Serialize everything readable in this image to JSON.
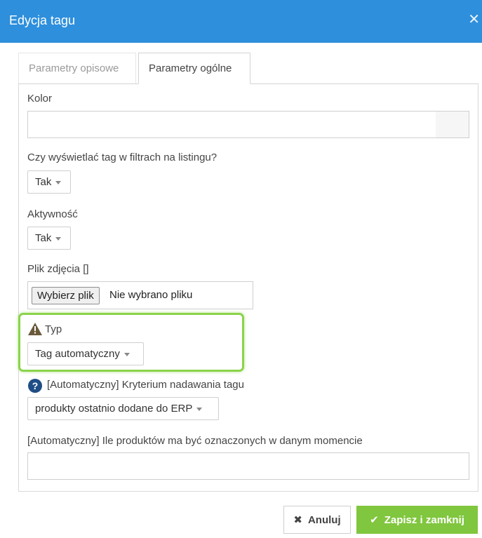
{
  "dialog": {
    "title": "Edycja tagu",
    "close_icon": "close-icon"
  },
  "tabs": [
    {
      "label": "Parametry opisowe",
      "active": false
    },
    {
      "label": "Parametry ogólne",
      "active": true
    }
  ],
  "form": {
    "color": {
      "label": "Kolor",
      "value": ""
    },
    "filter_display": {
      "label": "Czy wyświetlać tag w filtrach na listingu?",
      "selected": "Tak"
    },
    "activity": {
      "label": "Aktywność",
      "selected": "Tak"
    },
    "image_file": {
      "label": "Plik zdjęcia []",
      "button": "Wybierz plik",
      "status": "Nie wybrano pliku"
    },
    "type": {
      "label": "Typ",
      "selected": "Tag automatyczny",
      "icon": "warning-icon"
    },
    "criterion": {
      "label": "[Automatyczny] Kryterium nadawania tagu",
      "selected": "produkty ostatnio dodane do ERP",
      "icon": "help-icon"
    },
    "count": {
      "label": "[Automatyczny] Ile produktów ma być oznaczonych w danym momencie",
      "value": ""
    }
  },
  "actions": {
    "cancel": "Anuluj",
    "save": "Zapisz i zamknij"
  },
  "colors": {
    "header": "#2e8fdc",
    "highlight": "#8bd34c",
    "save": "#80c63e"
  }
}
